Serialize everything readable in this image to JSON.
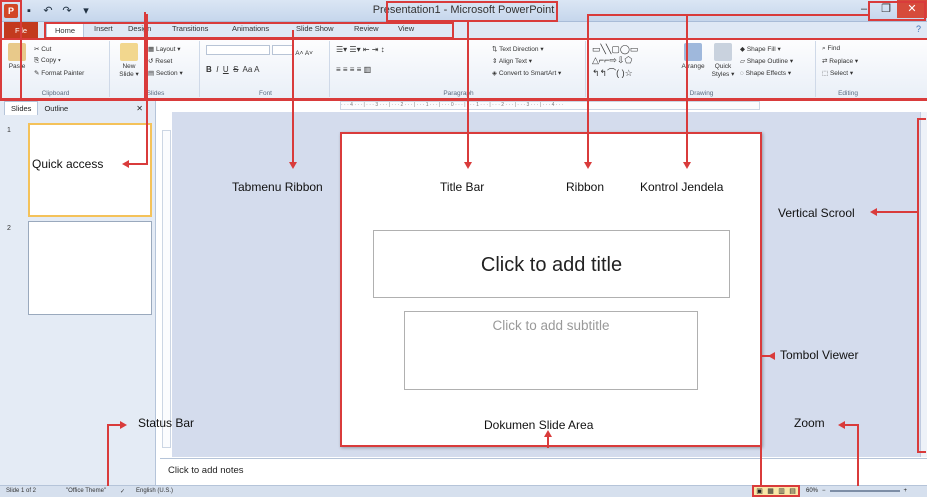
{
  "window": {
    "title": "Presentation1 - Microsoft PowerPoint",
    "app_icon": "P",
    "qa_icons": [
      "save-icon",
      "undo-icon",
      "redo-icon",
      "customize-icon"
    ],
    "controls": {
      "minimize": "–",
      "restore": "❐",
      "close": "✕"
    }
  },
  "tabs": [
    "File",
    "Home",
    "Insert",
    "Design",
    "Transitions",
    "Animations",
    "Slide Show",
    "Review",
    "View"
  ],
  "ribbon": {
    "clipboard": {
      "paste": "Paste",
      "cut": "Cut",
      "copy": "Copy ▾",
      "format_painter": "Format Painter",
      "label": "Clipboard"
    },
    "slides": {
      "new_slide": "New Slide ▾",
      "layout": "Layout ▾",
      "reset": "Reset",
      "section": "Section ▾",
      "label": "Slides"
    },
    "font": {
      "bold": "B",
      "italic": "I",
      "underline": "U",
      "strike": "S",
      "label": "Font"
    },
    "paragraph": {
      "text_direction": "Text Direction ▾",
      "align_text": "Align Text ▾",
      "smartart": "Convert to SmartArt ▾",
      "label": "Paragraph"
    },
    "drawing": {
      "arrange": "Arrange",
      "quick_styles": "Quick Styles ▾",
      "shape_fill": "Shape Fill ▾",
      "shape_outline": "Shape Outline ▾",
      "shape_effects": "Shape Effects ▾",
      "label": "Drawing"
    },
    "editing": {
      "find": "Find",
      "replace": "Replace ▾",
      "select": "Select ▾",
      "label": "Editing"
    }
  },
  "panel": {
    "tab_slides": "Slides",
    "tab_outline": "Outline",
    "close": "✕",
    "thumb1_num": "1",
    "thumb2_num": "2"
  },
  "slide": {
    "title_placeholder": "Click to add title",
    "subtitle_placeholder": "Click to add subtitle"
  },
  "notes": {
    "placeholder": "Click to add notes"
  },
  "status": {
    "slide_count": "Slide 1 of 2",
    "theme": "\"Office Theme\"",
    "language": "English (U.S.)",
    "zoom": "60%",
    "zoom_minus": "−",
    "zoom_plus": "+"
  },
  "annotations": {
    "quick_access": "Quick access",
    "tabmenu_ribbon": "Tabmenu Ribbon",
    "title_bar": "Title Bar",
    "ribbon": "Ribbon",
    "kontrol_jendela": "Kontrol Jendela",
    "vertical_scroll": "Vertical Scrool",
    "tombol_viewer": "Tombol Viewer",
    "status_bar": "Status Bar",
    "zoom": "Zoom",
    "dokumen_slide_area": "Dokumen Slide Area"
  },
  "colors": {
    "annotation": "#d93b3b",
    "file_tab": "#c33a1e"
  }
}
